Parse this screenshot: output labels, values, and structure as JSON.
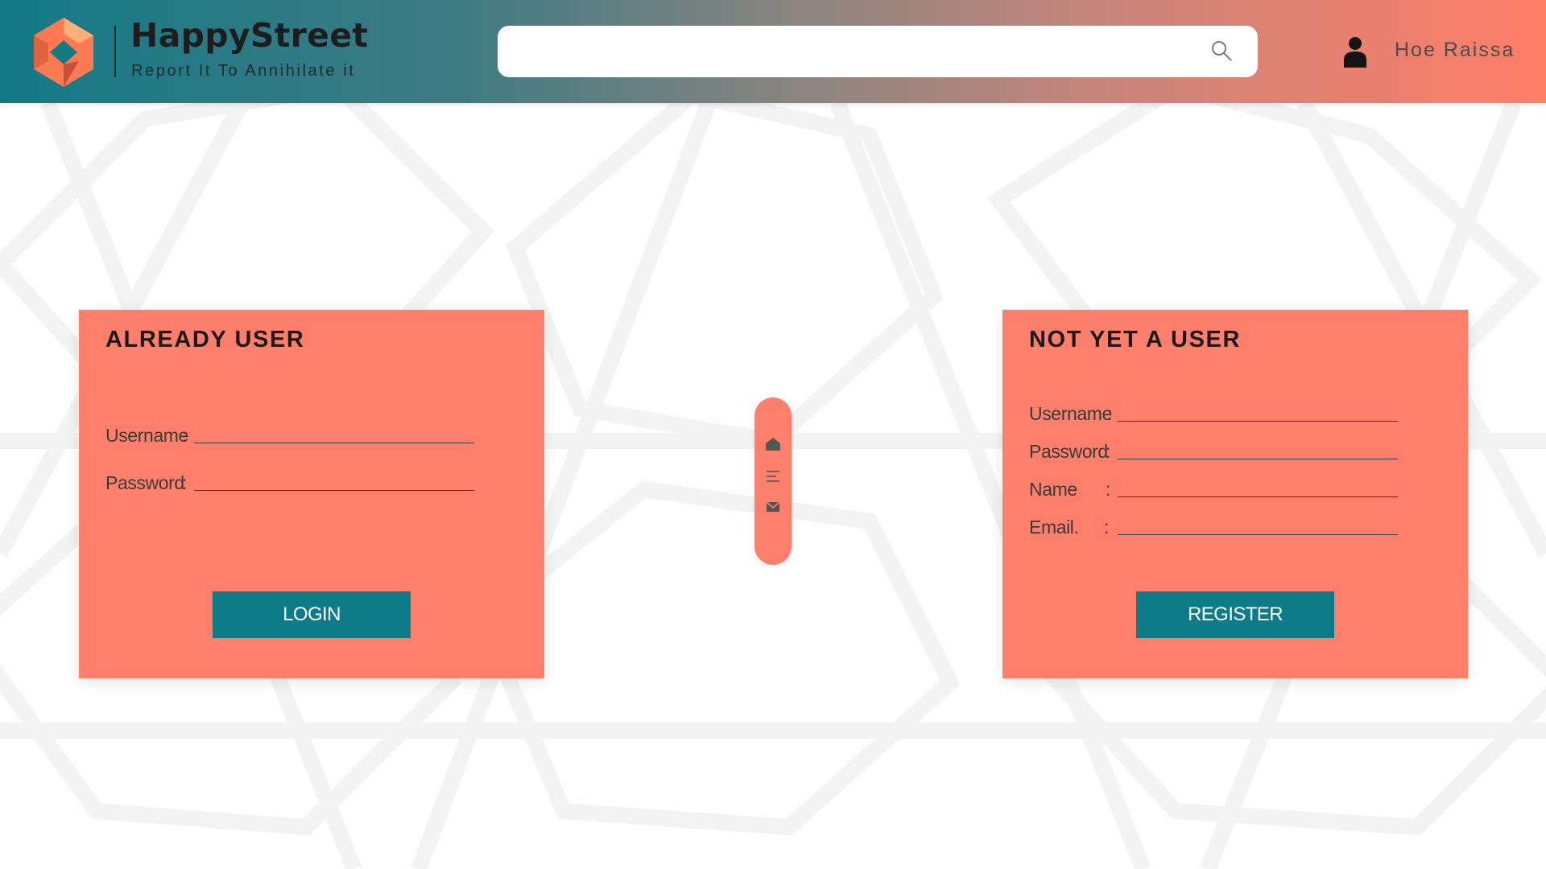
{
  "header": {
    "brand_name": "HappyStreet",
    "brand_tagline": "Report It To Annihilate it",
    "search": {
      "value": "",
      "placeholder": ""
    },
    "user_name": "Hoe Raissa"
  },
  "login_card": {
    "title": "ALREADY USER",
    "fields": [
      {
        "label": "Username",
        "colon": ":",
        "value": ""
      },
      {
        "label": "Password",
        "colon": ":",
        "value": ""
      }
    ],
    "button_label": "LOGIN"
  },
  "register_card": {
    "title": "NOT YET A USER",
    "fields": [
      {
        "label": "Username",
        "colon": ":",
        "value": ""
      },
      {
        "label": "Password",
        "colon": ":",
        "value": ""
      },
      {
        "label": "Name",
        "colon": ":",
        "value": ""
      },
      {
        "label": "Email.",
        "colon": ":",
        "value": ""
      }
    ],
    "button_label": "REGISTER"
  },
  "nav_pill": {
    "icons": [
      "home-icon",
      "menu-icon",
      "mail-icon"
    ]
  },
  "colors": {
    "header_gradient_start": "#137a86",
    "header_gradient_end": "#ff7e68",
    "card_background": "#fe7f6c",
    "button_background": "#0e7b89",
    "logo_orange": "#ff7a52"
  }
}
